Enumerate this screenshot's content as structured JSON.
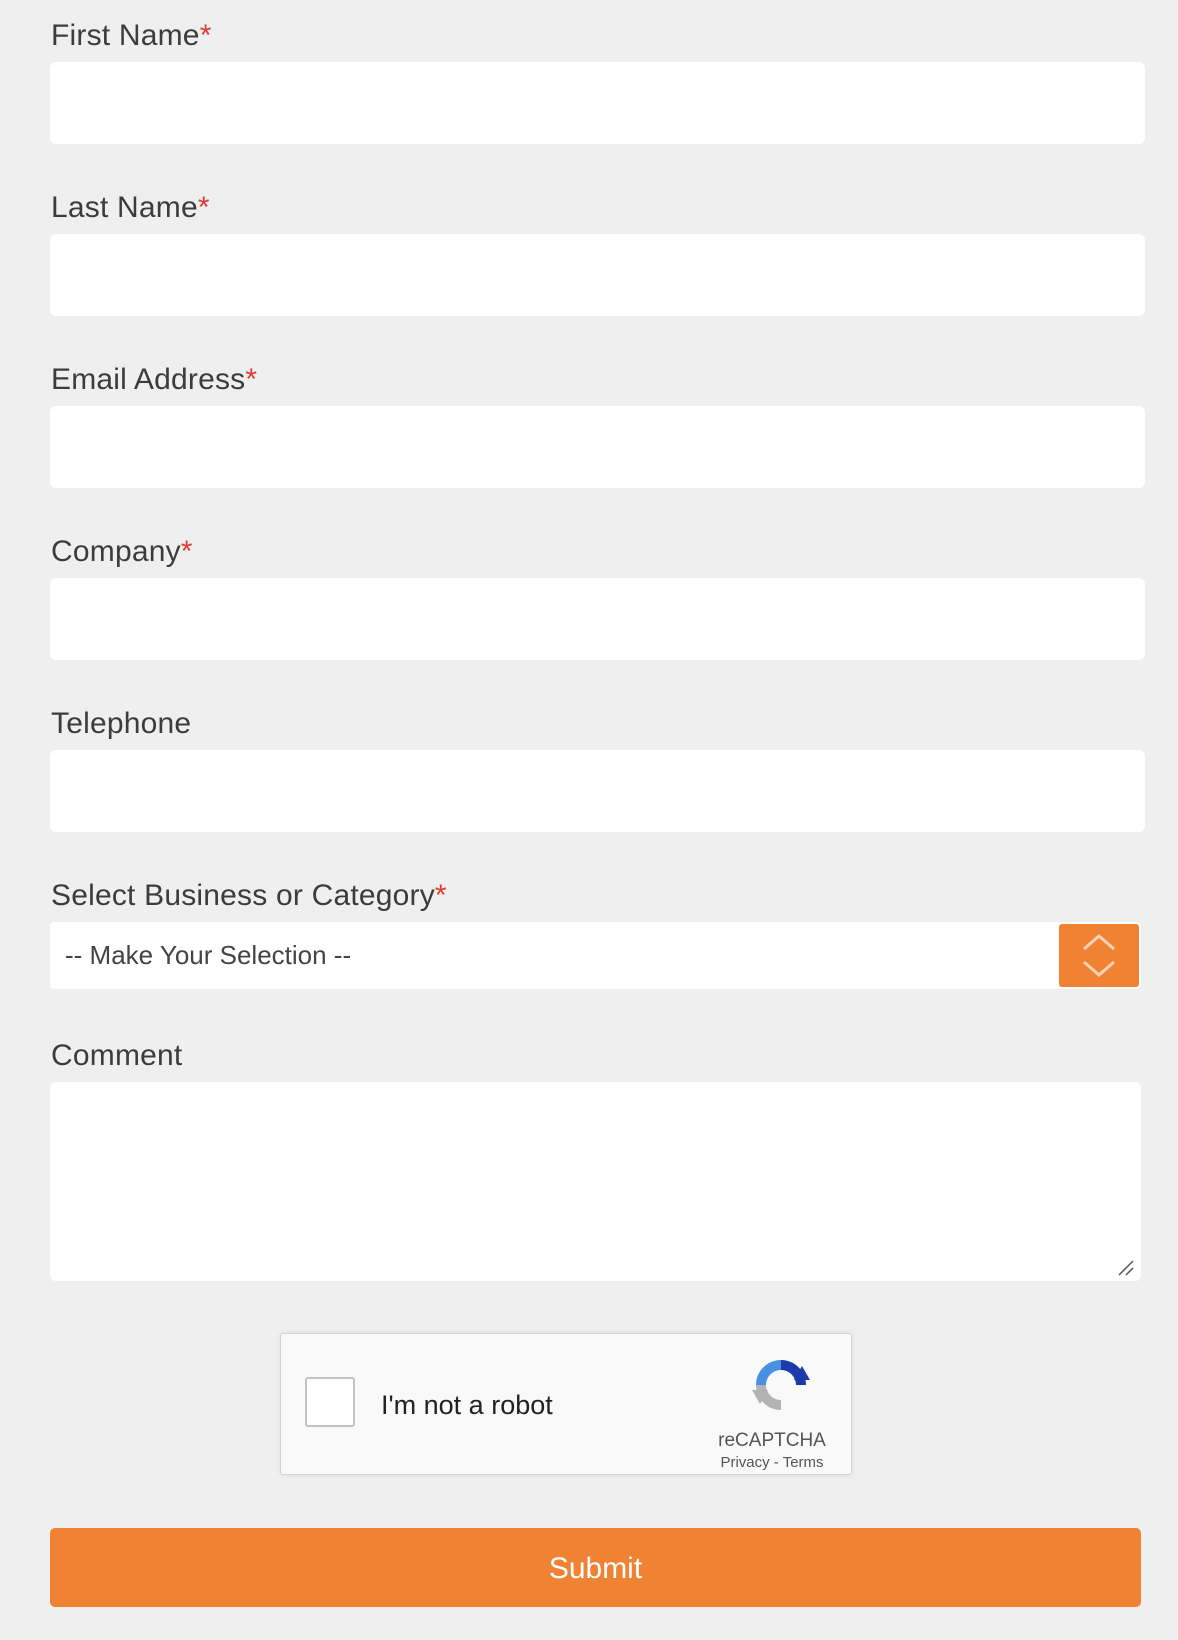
{
  "form": {
    "first_name": {
      "label": "First Name",
      "required_mark": "*",
      "value": ""
    },
    "last_name": {
      "label": "Last Name",
      "required_mark": "*",
      "value": ""
    },
    "email": {
      "label": "Email Address",
      "required_mark": "*",
      "value": ""
    },
    "company": {
      "label": "Company",
      "required_mark": "*",
      "value": ""
    },
    "telephone": {
      "label": "Telephone",
      "value": ""
    },
    "business": {
      "label": "Select Business or Category",
      "required_mark": "*",
      "selected": "-- Make Your Selection --"
    },
    "comment": {
      "label": "Comment",
      "value": ""
    },
    "submit_label": "Submit"
  },
  "recaptcha": {
    "checkbox_label": "I'm not a robot",
    "brand": "reCAPTCHA",
    "privacy": "Privacy",
    "separator": " - ",
    "terms": "Terms"
  },
  "colors": {
    "accent": "#f08233",
    "required": "#e03c31",
    "background": "#efefef"
  },
  "icons": {
    "select_toggle": "chevron-up-down-icon",
    "resize": "resize-handle-icon",
    "recaptcha_logo": "recaptcha-logo-icon"
  }
}
